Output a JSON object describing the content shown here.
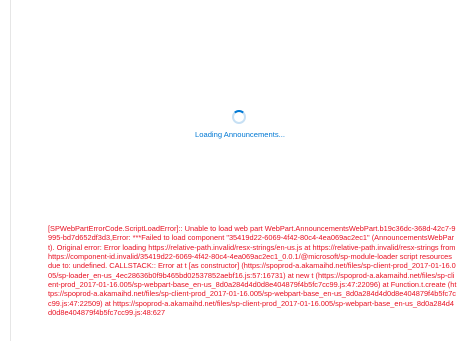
{
  "webpart": {
    "loading_label": "Loading Announcements...",
    "spinner_color": "#0078d4",
    "error_color": "#e81123",
    "error_message": "[SPWebPartErrorCode.ScriptLoadError]:: Unable to load web part WebPart.AnnouncementsWebPart.b19c36dc-368d-42c7-9995-bd7d652df3d3,Error: ***Failed to load component \"35419d22-6069-4f42-80c4-4ea069ac2ec1\" (AnnouncementsWebPart). Original error: Error loading https://relative-path.invalid/resx-strings/en-us.js at https://relative-path.invalid/resx-strings from https://component-id.invalid/35419d22-6069-4f42-80c4-4ea069ac2ec1_0.0.1/@microsoft/sp-module-loader script resources due to: undefined. CALLSTACK:: Error at t [as constructor] (https://spoprod-a.akamaihd.net/files/sp-client-prod_2017-01-16.005/sp-loader_en-us_4ec28636b0f9b465bd02537852aebf16.js:57:16731) at new t (https://spoprod-a.akamaihd.net/files/sp-client-prod_2017-01-16.005/sp-webpart-base_en-us_8d0a284d4d0d8e404879f4b5fc7cc99.js:47:22096) at Function.t.create (https://spoprod-a.akamaihd.net/files/sp-client-prod_2017-01-16.005/sp-webpart-base_en-us_8d0a284d4d0d8e404879f4b5fc7cc99.js:47:22509) at https://spoprod-a.akamaihd.net/files/sp-client-prod_2017-01-16.005/sp-webpart-base_en-us_8d0a284d4d0d8e404879f4b5fc7cc99.js:48:627"
  }
}
